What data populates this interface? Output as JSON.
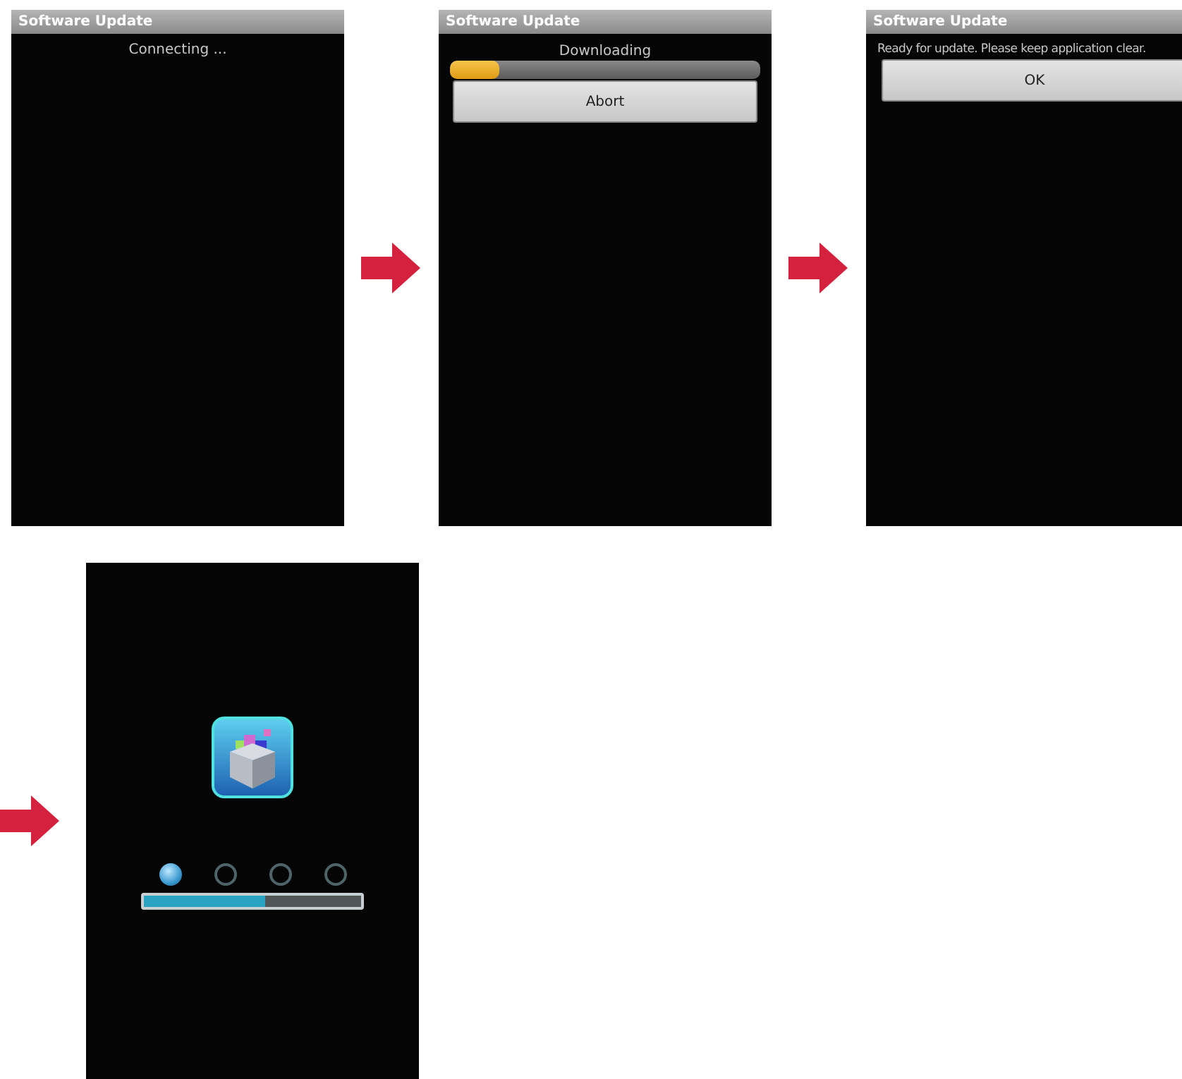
{
  "screens": [
    {
      "kind": "status",
      "title": "Software Update",
      "message": "Connecting ..."
    },
    {
      "kind": "progress",
      "title": "Software Update",
      "message": "Downloading",
      "level": 0.16,
      "button": "Abort"
    },
    {
      "kind": "confirm",
      "title": "Software Update",
      "message": "Ready for update. Please keep application clear.",
      "button": "OK"
    },
    {
      "kind": "install",
      "steps": [
        {
          "selected": true
        },
        {
          "selected": false
        },
        {
          "selected": false
        },
        {
          "selected": false
        }
      ],
      "level": 0.56
    }
  ]
}
